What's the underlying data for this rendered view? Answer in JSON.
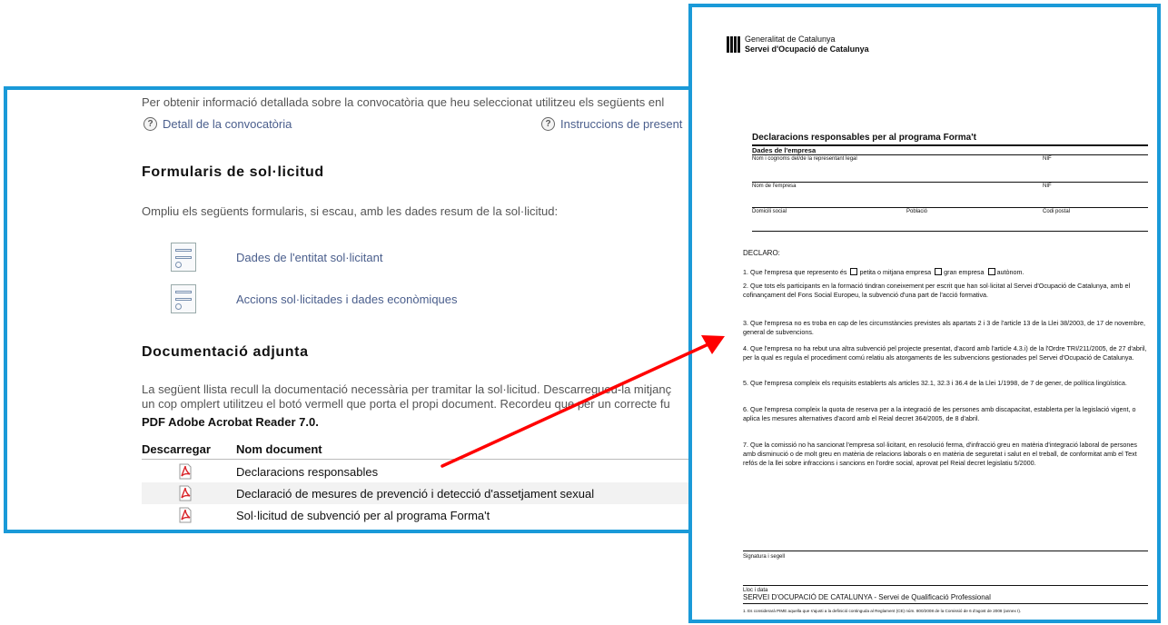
{
  "web": {
    "intro_text": "Per obtenir informació detallada sobre la convocatòria que heu seleccionat utilitzeu els següents enl",
    "links": [
      {
        "label": "Detall de la convocatòria"
      },
      {
        "label": "Instruccions de present"
      }
    ],
    "forms_section": {
      "title": "Formularis de sol·licitud",
      "description": "Ompliu els següents formularis, si escau, amb les dades resum de la sol·licitud:",
      "items": [
        {
          "label": "Dades de l'entitat sol·licitant",
          "icon": "form-icon"
        },
        {
          "label": "Accions sol·licitades i dades econòmiques",
          "icon": "form-icon"
        }
      ]
    },
    "docs_section": {
      "title": "Documentació adjunta",
      "line1": "La següent llista recull la documentació necessària per tramitar la sol·licitud. Descarregueu-la mitjanç",
      "line2": "un cop omplert utilitzeu el botó vermell que porta el propi document. Recordeu que per un correcte fu",
      "reader_note": "PDF Adobe Acrobat Reader 7.0.",
      "col_download": "Descarregar",
      "col_name": "Nom document",
      "rows": [
        {
          "name": "Declaracions responsables",
          "icon": "pdf-icon"
        },
        {
          "name": "Declaració de mesures de prevenció i detecció d'assetjament sexual",
          "icon": "pdf-icon"
        },
        {
          "name": "Sol·licitud de subvenció per al programa Forma't",
          "icon": "pdf-icon"
        }
      ]
    }
  },
  "doc": {
    "org_line1": "Generalitat de Catalunya",
    "org_line2": "Servei d'Ocupació de Catalunya",
    "title": "Declaracions responsables per al programa Forma't",
    "company_section": "Dades de l'empresa",
    "fields": {
      "legal_rep": "Nom i cognoms del/de la representant legal",
      "nif1": "NIF",
      "company_name": "Nom de l'empresa",
      "nif2": "NIF",
      "address": "Domicili social",
      "town": "Població",
      "postcode": "Codi postal"
    },
    "declaro": "DECLARO:",
    "item1": {
      "text": "1. Que l'empresa que represento és",
      "opt1": "petita o mitjana empresa",
      "opt2": "gran empresa",
      "opt3": "autònom."
    },
    "items": [
      "2. Que tots els participants en la formació tindran coneixement per escrit que han sol·licitat al Servei d'Ocupació de Catalunya, amb el cofinançament del Fons Social Europeu, la subvenció d'una part de l'acció formativa.",
      "3. Que l'empresa no es troba en cap de les circumstàncies previstes als apartats 2 i 3 de l'article 13 de la Llei 38/2003, de 17 de novembre, general de subvencions.",
      "4. Que l'empresa no ha rebut una altra subvenció pel projecte presentat, d'acord amb l'article 4.3.i) de la l'Ordre TRI/211/2005, de 27 d'abril, per la qual es regula el procediment comú relatiu als atorgaments de les subvencions gestionades pel Servei d'Ocupació de Catalunya.",
      "5. Que l'empresa compleix els requisits establerts als articles 32.1, 32.3 i 36.4 de la Llei 1/1998, de 7 de gener, de política lingüística.",
      "6. Que l'empresa compleix la quota de reserva per a la integració de les persones amb discapacitat, establerta per la legislació vigent, o aplica les mesures alternatives d'acord amb el Reial decret 364/2005, de 8 d'abril.",
      "7. Que la comissió no ha sancionat l'empresa sol·licitant, en resolució ferma, d'infracció greu en matèria d'integració laboral de persones amb disminució o de molt greu en matèria de relacions laborals o en matèria de seguretat i salut en el treball, de conformitat amb el Text refós de la llei sobre infraccions i sancions en l'ordre social, aprovat pel Reial decret legislatiu 5/2000."
    ],
    "signature": "Signatura i segell",
    "place_date": "Lloc i data",
    "footer_org": "SERVEI D'OCUPACIÓ DE CATALUNYA - Servei de Qualificació Professional",
    "footnote": "1. Es considerarà PIME aquella que s'ajusti a la definició continguda al Reglament (CE) núm. 800/2008 de la Comissió de 6 d'agost de 2008 (annex I)."
  },
  "colors": {
    "frame": "#1a9ad8",
    "arrow": "#ff0000",
    "link": "#4a5e8c",
    "pdf": "#d9252a"
  }
}
